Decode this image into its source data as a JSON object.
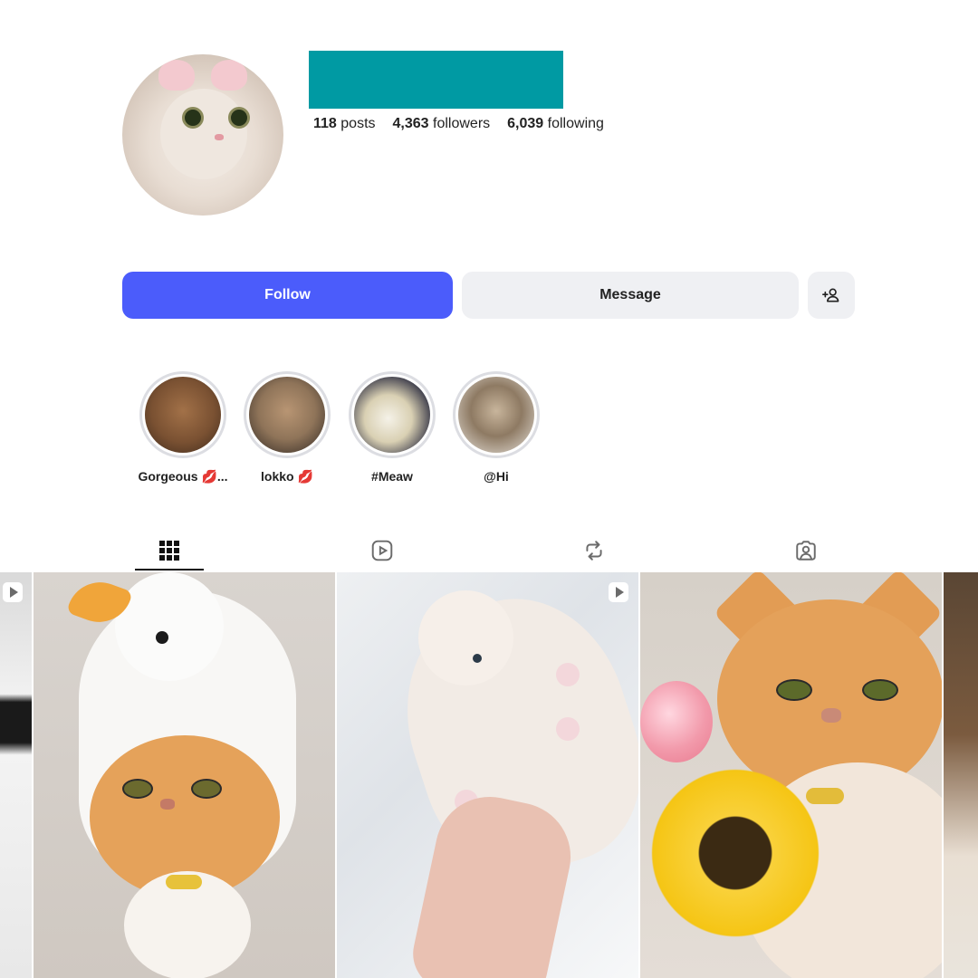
{
  "profile": {
    "stats": {
      "posts_value": "118",
      "posts_label": "posts",
      "followers_value": "4,363",
      "followers_label": "followers",
      "following_value": "6,039",
      "following_label": "following"
    }
  },
  "actions": {
    "follow_label": "Follow",
    "message_label": "Message",
    "add_user_icon": "add-user-icon"
  },
  "highlights": [
    {
      "label": "Gorgeous 💋..."
    },
    {
      "label": "lokko 💋"
    },
    {
      "label": "#Meaw"
    },
    {
      "label": "@Hi"
    }
  ],
  "tabs": [
    {
      "name": "posts",
      "icon": "grid-icon",
      "active": true
    },
    {
      "name": "reels",
      "icon": "reels-icon",
      "active": false
    },
    {
      "name": "reposts",
      "icon": "repost-icon",
      "active": false
    },
    {
      "name": "tagged",
      "icon": "tagged-icon",
      "active": false
    }
  ],
  "colors": {
    "follow_button": "#4b5cfb",
    "secondary_button": "#eff0f3",
    "username_redaction": "#009aa3"
  }
}
